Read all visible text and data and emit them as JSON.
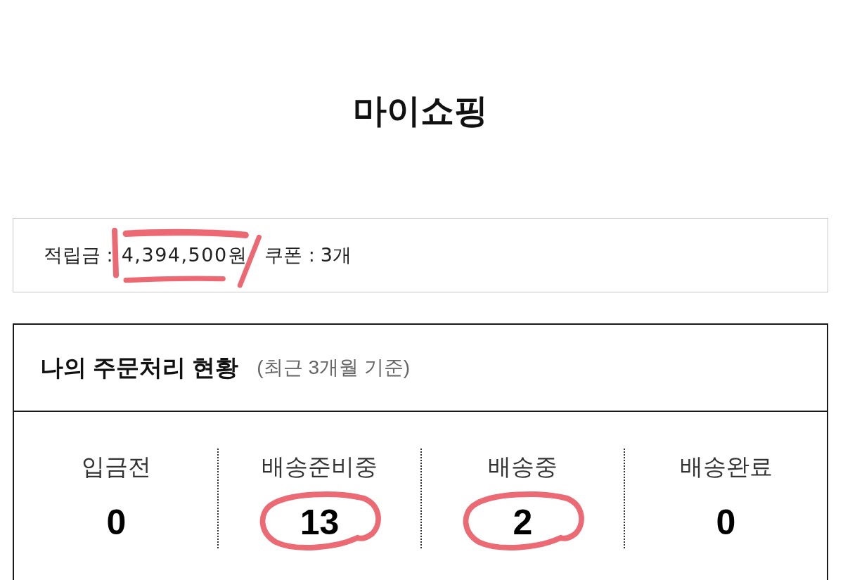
{
  "page": {
    "title": "마이쇼핑"
  },
  "summary": {
    "points_label": "적립금 :",
    "points_value": "4,394,500원",
    "points_marked": true,
    "coupons_label": "쿠폰 :",
    "coupons_value": "3개"
  },
  "order_status": {
    "title": "나의 주문처리 현황",
    "subtitle": "(최근 3개월 기준)",
    "stages": [
      {
        "label": "입금전",
        "count": "0",
        "circled": false
      },
      {
        "label": "배송준비중",
        "count": "13",
        "circled": true
      },
      {
        "label": "배송중",
        "count": "2",
        "circled": true
      },
      {
        "label": "배송완료",
        "count": "0",
        "circled": false
      }
    ]
  }
}
